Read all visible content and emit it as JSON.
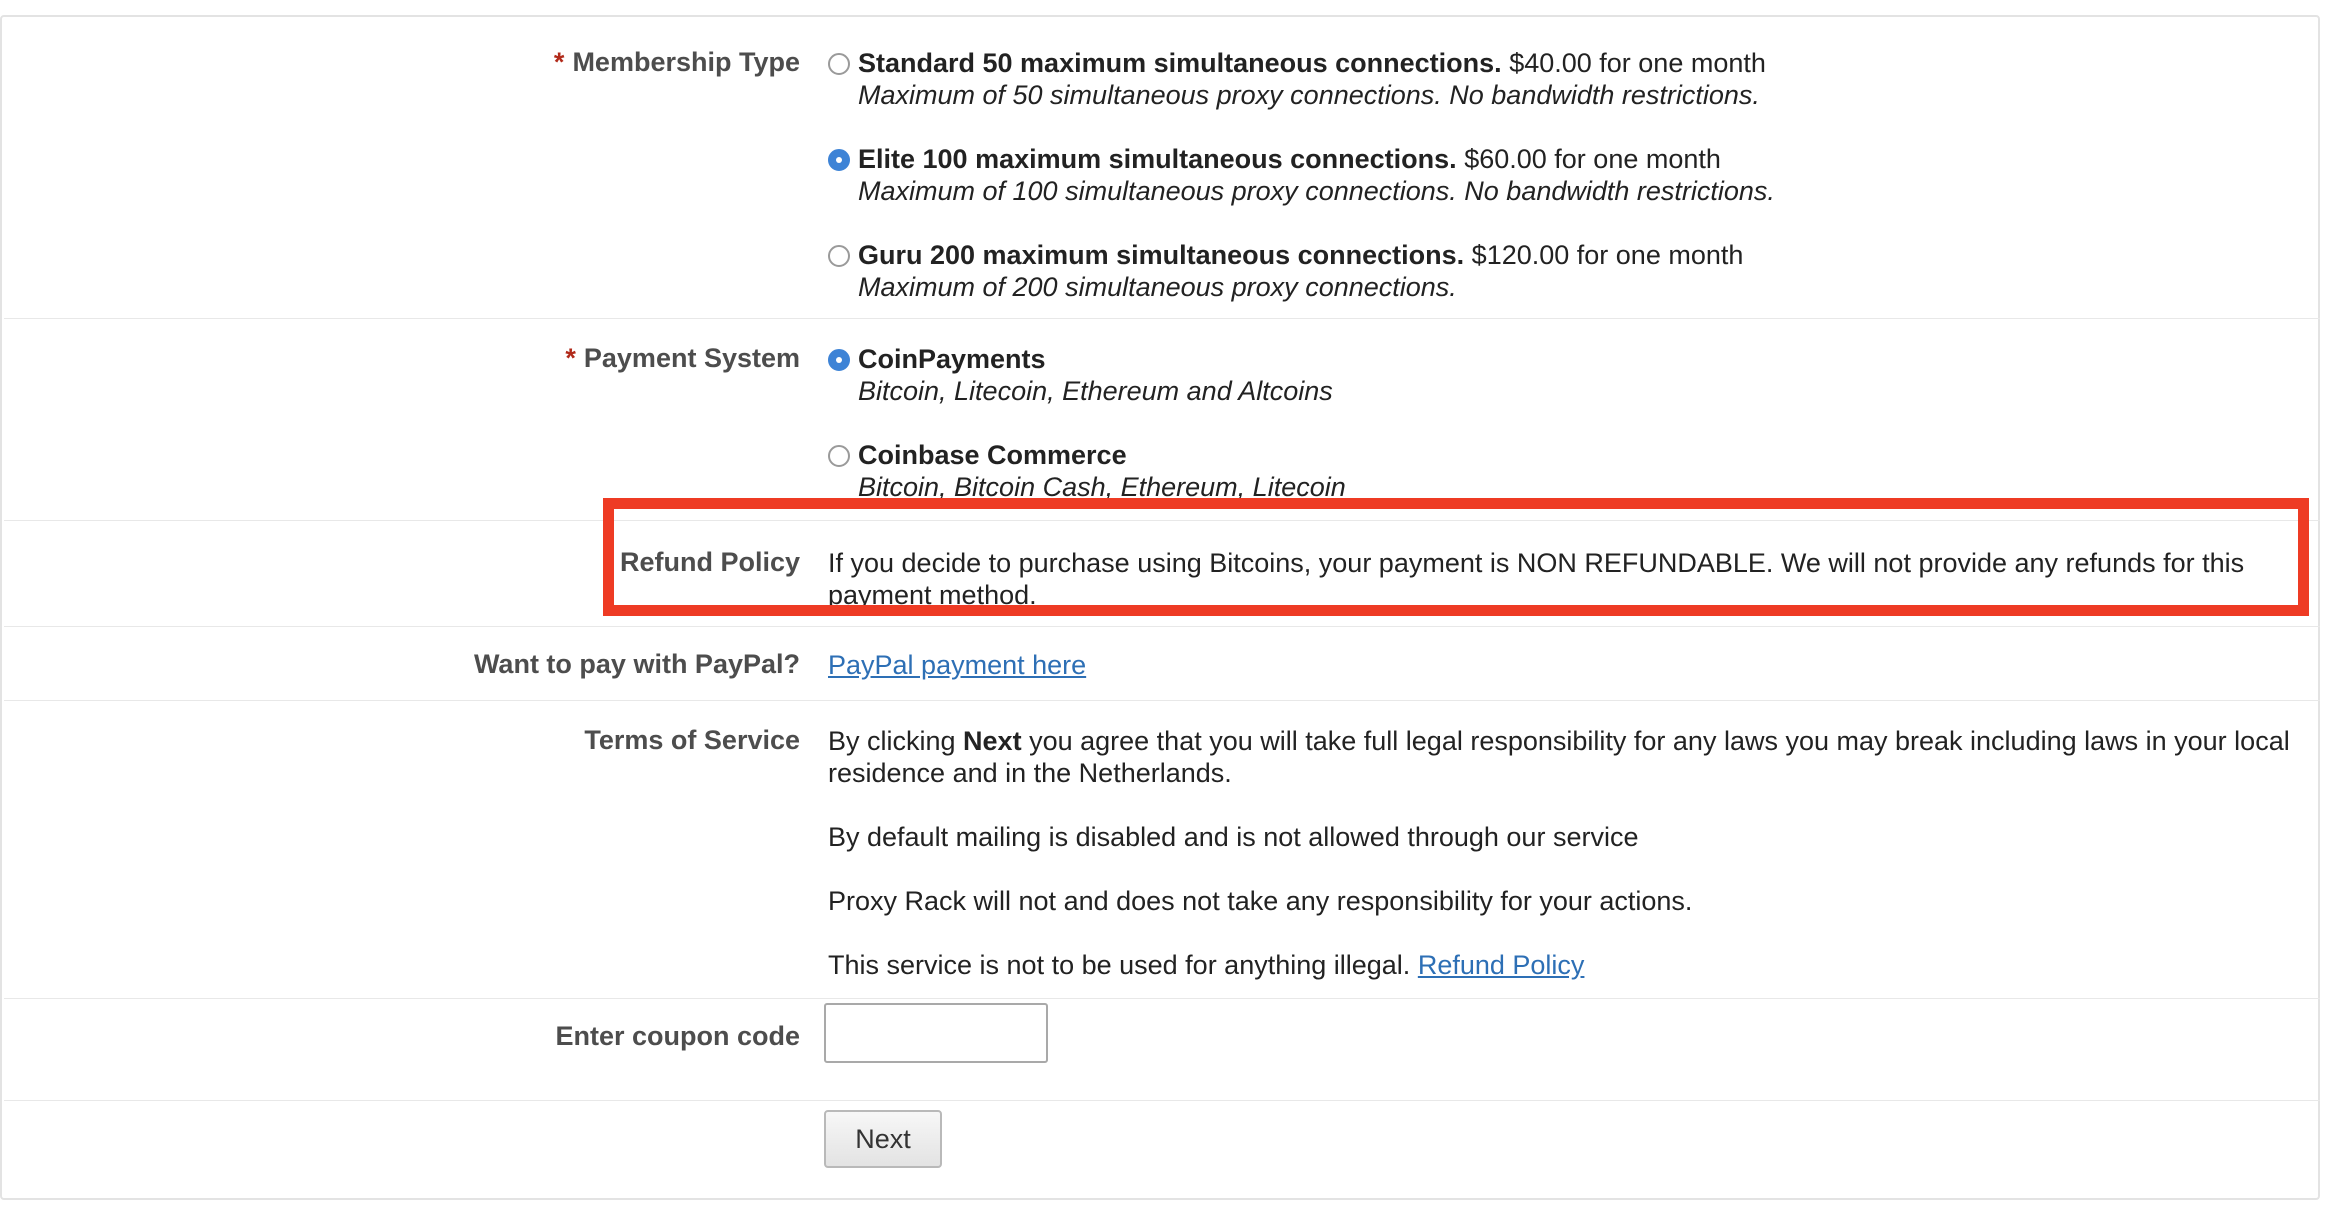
{
  "membership": {
    "label": "Membership Type",
    "required_mark": "*",
    "options": [
      {
        "title": "Standard 50 maximum simultaneous connections.",
        "price": "$40.00 for one month",
        "desc": "Maximum of 50 simultaneous proxy connections. No bandwidth restrictions.",
        "selected": false
      },
      {
        "title": "Elite 100 maximum simultaneous connections.",
        "price": "$60.00 for one month",
        "desc": "Maximum of 100 simultaneous proxy connections. No bandwidth restrictions.",
        "selected": true
      },
      {
        "title": "Guru 200 maximum simultaneous connections.",
        "price": "$120.00 for one month",
        "desc": "Maximum of 200 simultaneous proxy connections.",
        "selected": false
      }
    ]
  },
  "payment": {
    "label": "Payment System",
    "required_mark": "*",
    "options": [
      {
        "title": "CoinPayments",
        "desc": "Bitcoin, Litecoin, Ethereum and Altcoins",
        "selected": true
      },
      {
        "title": "Coinbase Commerce",
        "desc": "Bitcoin, Bitcoin Cash, Ethereum, Litecoin",
        "selected": false
      }
    ]
  },
  "refund": {
    "label": "Refund Policy",
    "text": "If you decide to purchase using Bitcoins, your payment is NON REFUNDABLE. We will not provide any refunds for this payment method."
  },
  "paypal": {
    "label": "Want to pay with PayPal?",
    "link": "PayPal payment here"
  },
  "terms": {
    "label": "Terms of Service",
    "p1_before": "By clicking ",
    "p1_bold": "Next",
    "p1_after": " you agree that you will take full legal responsibility for any laws you may break including laws in your local residence and in the Netherlands.",
    "p2": "By default mailing is disabled and is not allowed through our service",
    "p3": "Proxy Rack will not and does not take any responsibility for your actions.",
    "p4": "This service is not to be used for anything illegal.",
    "p4_link": "Refund Policy"
  },
  "coupon": {
    "label": "Enter coupon code",
    "value": "",
    "placeholder": ""
  },
  "next_button": "Next",
  "colors": {
    "highlight": "#ee3b24",
    "link": "#2d6fb5",
    "radio_checked": "#3d83d6",
    "required": "#b12a1a"
  }
}
